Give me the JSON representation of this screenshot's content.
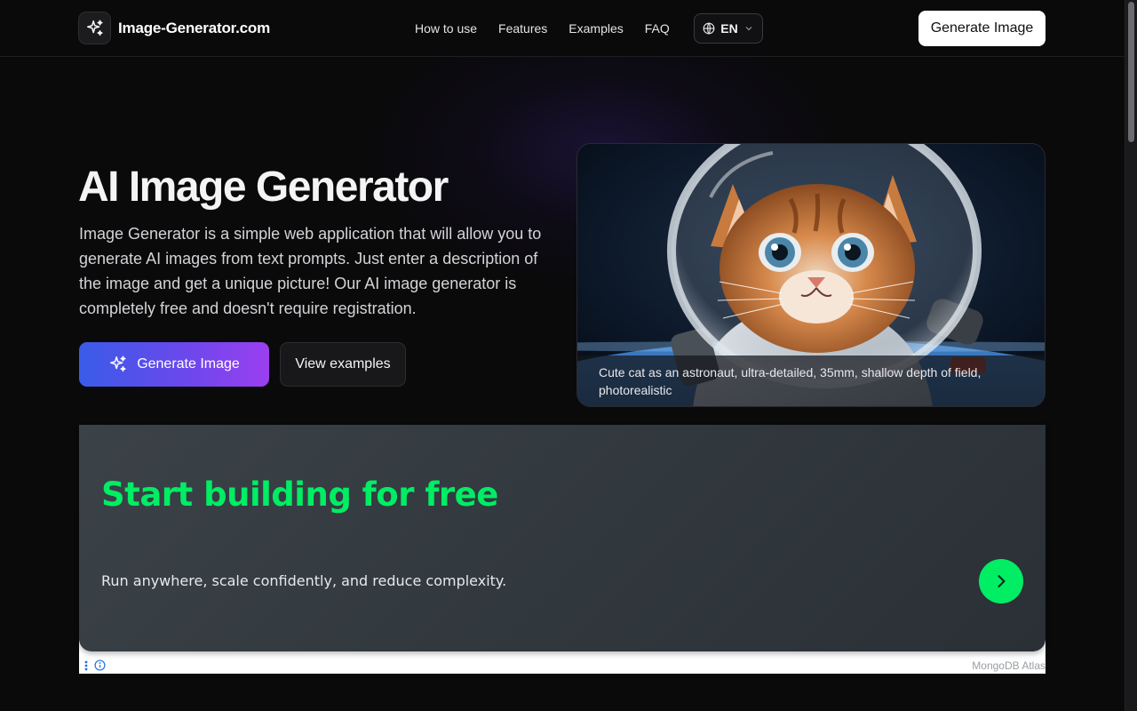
{
  "header": {
    "brand": "Image-Generator.com",
    "nav": [
      {
        "label": "How to use"
      },
      {
        "label": "Features"
      },
      {
        "label": "Examples"
      },
      {
        "label": "FAQ"
      }
    ],
    "language": "EN",
    "cta": "Generate Image"
  },
  "hero": {
    "title": "AI Image Generator",
    "description": "Image Generator is a simple web application that will allow you to generate AI images from text prompts. Just enter a description of the image and get a unique picture! Our AI image generator is completely free and doesn't require registration.",
    "primary_button": "Generate Image",
    "secondary_button": "View examples",
    "image_caption": "Cute cat as an astronaut, ultra-detailed, 35mm, shallow depth of field, photorealistic"
  },
  "ad": {
    "title": "Start building for free",
    "subtitle": "Run anywhere, scale confidently, and reduce complexity.",
    "source": "MongoDB Atlas",
    "accent": "#00ed64"
  },
  "colors": {
    "background": "#0a0a0b",
    "gradient_start": "#3a5ce8",
    "gradient_end": "#9b3ff0"
  }
}
